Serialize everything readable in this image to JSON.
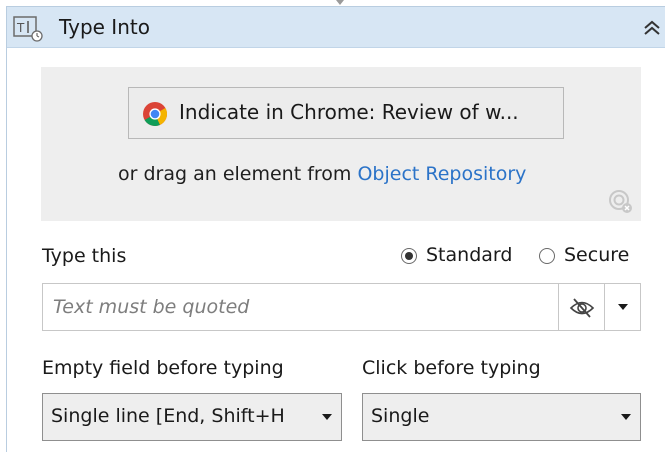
{
  "activity": {
    "title": "Type Into"
  },
  "target": {
    "indicate_label": "Indicate in Chrome: Review of w...",
    "drag_prefix": "or drag an element from ",
    "object_repository_link": "Object Repository"
  },
  "type_this": {
    "label": "Type this",
    "mode_options": [
      "Standard",
      "Secure"
    ],
    "selected_mode": "Standard",
    "placeholder": "Text must be quoted",
    "value": ""
  },
  "empty_field": {
    "label": "Empty field before typing",
    "selected": "Single line [End, Shift+H"
  },
  "click_before": {
    "label": "Click before typing",
    "selected": "Single"
  },
  "icons": {
    "activity": "type-into-icon",
    "collapse": "double-chevron-up-icon",
    "browser": "chrome-icon",
    "target": "target-icon",
    "visibility": "eye-slash-icon",
    "dropdown": "chevron-down-icon"
  },
  "colors": {
    "header_bg": "#d7e6f4",
    "panel_bg": "#eeeeee",
    "link": "#2b73c8"
  }
}
